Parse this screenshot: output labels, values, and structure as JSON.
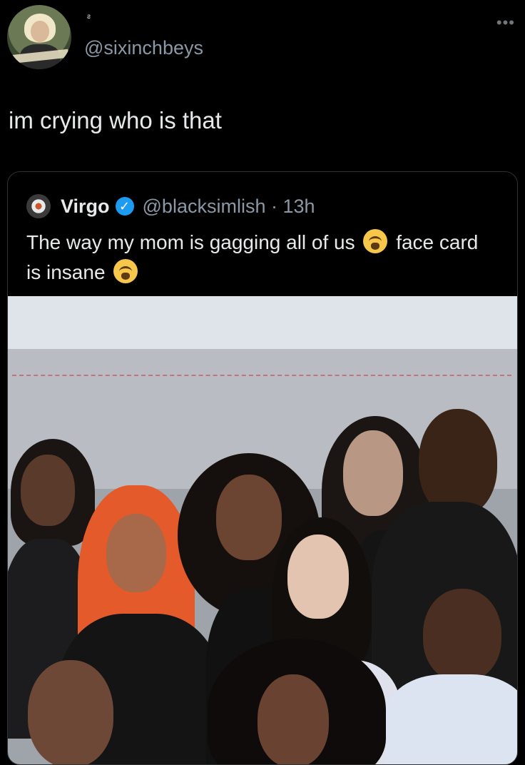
{
  "tweet": {
    "name_mark": "ƨ",
    "handle": "@sixinchbeys",
    "more_icon": "more-dots-icon",
    "text": "im crying who is that"
  },
  "quoted": {
    "name": "Virgo",
    "verified_icon": "verified-badge-icon",
    "handle": "@blacksimlish",
    "separator": "·",
    "time": "13h",
    "text_part1": "The way my mom is gagging all of us",
    "emoji1": "😭",
    "text_part2": "face card is insane",
    "emoji2": "😭"
  },
  "colors": {
    "background": "#000000",
    "text": "#e7e9ea",
    "secondary": "#8b98a5",
    "verified": "#1d9bf0"
  }
}
